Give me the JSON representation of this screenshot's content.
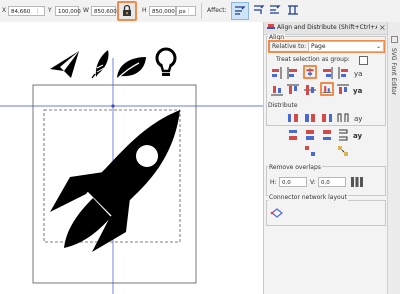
{
  "toolbar": {
    "x_label": "X",
    "x_value": "84,660",
    "y_label": "Y",
    "y_value": "100,000",
    "w_label": "W",
    "w_value": "850,600",
    "h_label": "H",
    "h_value": "850,000",
    "unit": "px",
    "affect_label": "Affect:"
  },
  "panel": {
    "title": "Align and Distribute (Shift+Ctrl+A)",
    "close_glyph": "×",
    "align_section": "Align",
    "relative_to_label": "Relative to:",
    "relative_to_value": "Page",
    "treat_selection_label": "Treat selection as group:",
    "distribute_section": "Distribute",
    "remove_overlaps_section": "Remove overlaps",
    "h_label": "H:",
    "h_value": "0,0",
    "v_label": "V:",
    "v_value": "0,0",
    "connector_section": "Connector network layout"
  },
  "side_tab": {
    "label": "SVG Font Editor"
  },
  "colors": {
    "highlight": "#ef8c4b",
    "guide": "#3a4fd1",
    "icon_fill": "#000000"
  }
}
